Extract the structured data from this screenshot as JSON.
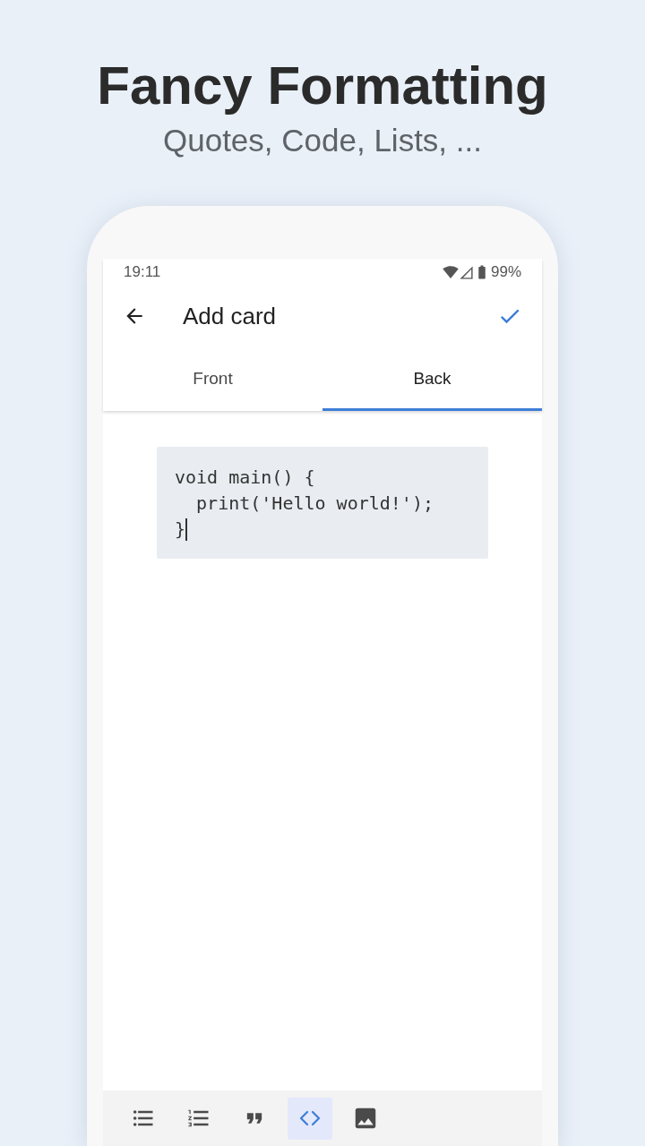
{
  "header": {
    "title": "Fancy Formatting",
    "subtitle": "Quotes, Code, Lists, ..."
  },
  "status_bar": {
    "time": "19:11",
    "battery": "99%"
  },
  "app_bar": {
    "title": "Add card"
  },
  "tabs": [
    {
      "label": "Front",
      "selected": false
    },
    {
      "label": "Back",
      "selected": true
    }
  ],
  "editor": {
    "code_lines": [
      "void main() {",
      "  print('Hello world!');",
      "}"
    ],
    "focused": true
  },
  "toolbar": [
    {
      "kind": "bullet-list",
      "selected": false
    },
    {
      "kind": "numbered-list",
      "selected": false
    },
    {
      "kind": "quote",
      "selected": false
    },
    {
      "kind": "code",
      "selected": true
    },
    {
      "kind": "image",
      "selected": false
    }
  ]
}
